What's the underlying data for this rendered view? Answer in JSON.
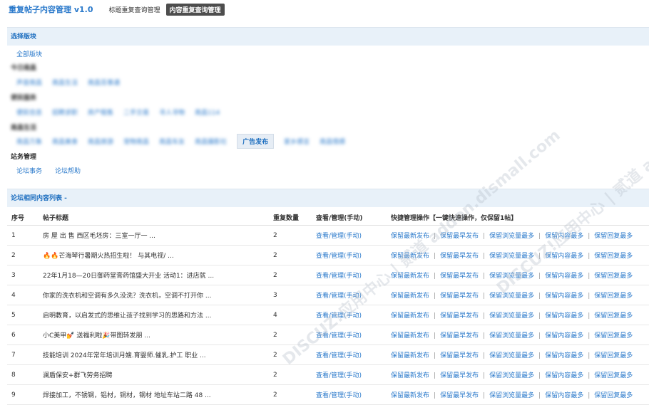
{
  "header": {
    "title": "重复帖子内容管理 v1.0",
    "tabs": [
      {
        "label": "标题重复查询管理",
        "active": false
      },
      {
        "label": "内容重复查询管理",
        "active": true
      }
    ]
  },
  "forum_section": {
    "title": "选择版块",
    "all_label": "全部版块",
    "groups": [
      {
        "title": "今日南昌",
        "blurred": true,
        "items": [
          "声音南昌",
          "南昌生活",
          "南昌百事通"
        ]
      },
      {
        "title": "便民服务",
        "blurred": true,
        "items": [
          "便民信息",
          "招聘求职",
          "房产租售",
          "二手交易",
          "寻人寻物",
          "南昌114"
        ]
      },
      {
        "title": "南昌生活",
        "blurred": true,
        "items": [
          "南昌万象",
          "南昌美食",
          "南昌旅游",
          "宠物南昌",
          "南昌车友",
          "南昌摄影社",
          "广告发布",
          "家乡感言",
          "南昌情感"
        ]
      },
      {
        "title": "站务管理",
        "blurred": false,
        "items": [
          "论坛事务",
          "论坛帮助"
        ]
      }
    ]
  },
  "list_section": {
    "title": "论坛相同内容列表 -",
    "columns": [
      "序号",
      "帖子标题",
      "重复数量",
      "查看/管理(手动)",
      "快捷管理操作【一键快速操作，仅保留1帖】"
    ],
    "view_label": "查看/管理(手动)",
    "ops": [
      "保留最新发布",
      "保留最早发布",
      "保留浏览量最多",
      "保留内容最多",
      "保留回复最多"
    ],
    "rows": [
      {
        "no": "1",
        "title": "房 屋 出 售 西区毛坯房：三室一厅一 ...",
        "count": "2"
      },
      {
        "no": "2",
        "title": "🔥🔥芒海琴行暑期火热招生啦！ 与其电视/ ...",
        "count": "2"
      },
      {
        "no": "3",
        "title": "22年1月18—20日御药堂膏药馆盛大开业 活动1：进店就 ...",
        "count": "2"
      },
      {
        "no": "4",
        "title": "你家的洗衣机和空调有多久没洗？洗衣机，空调不打开你 ...",
        "count": "3"
      },
      {
        "no": "5",
        "title": "启明教育，以启发式的思维让孩子找到学习的思路和方法 ...",
        "count": "4"
      },
      {
        "no": "6",
        "title": "小C美甲💅 送福利啦🎉带图转发朋 ...",
        "count": "2"
      },
      {
        "no": "7",
        "title": "技能培训 2024年常年培训月嫂.育婴师.催乳.护工 职业 ...",
        "count": "2"
      },
      {
        "no": "8",
        "title": "澜盾保安+群飞劳务招聘",
        "count": "2"
      },
      {
        "no": "9",
        "title": "焊接加工，不锈钢，铝材，铜材，钢材 地址车站二路 48 ...",
        "count": "2"
      }
    ]
  },
  "watermark": "DISCUZ!应用中心 | 贰道 addon.dismall.com"
}
